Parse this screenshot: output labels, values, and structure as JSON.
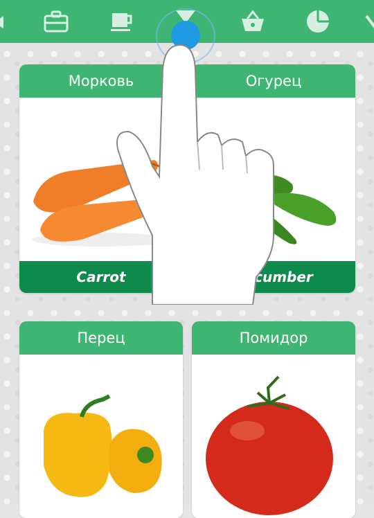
{
  "toolbar": {
    "icons": [
      "briefcase-icon",
      "cup-icon",
      "funnel-icon",
      "basket-icon",
      "pie-chart-icon"
    ],
    "selected": "funnel-icon"
  },
  "cards": [
    {
      "title": "Морковь",
      "caption": "Carrot"
    },
    {
      "title": "Огурец",
      "caption": "Cucumber"
    },
    {
      "title": "Перец",
      "caption": ""
    },
    {
      "title": "Помидор",
      "caption": ""
    }
  ],
  "colors": {
    "header": "#3fb573",
    "caption_bar": "#0f8a4d",
    "selection": "#1e9be2"
  }
}
